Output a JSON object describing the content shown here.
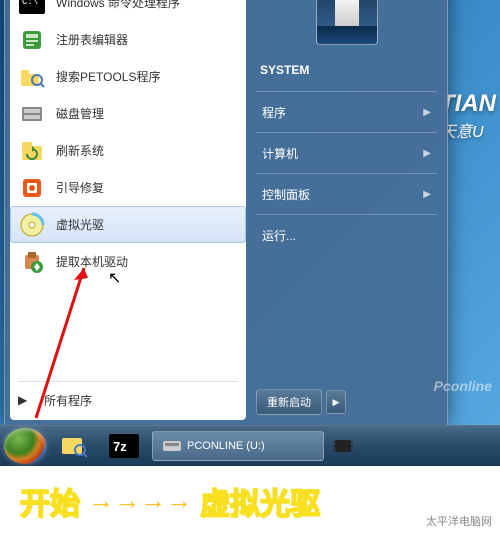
{
  "logo": {
    "main": "TIAN",
    "sub": "天意U"
  },
  "user": {
    "name": "SYSTEM"
  },
  "left_items": [
    {
      "label": "Windows 命令处理程序",
      "icon": "cmd"
    },
    {
      "label": "注册表编辑器",
      "icon": "regedit"
    },
    {
      "label": "搜索PETOOLS程序",
      "icon": "search"
    },
    {
      "label": "磁盘管理",
      "icon": "disk-mgmt"
    },
    {
      "label": "刷新系统",
      "icon": "refresh"
    },
    {
      "label": "引导修复",
      "icon": "boot-repair"
    },
    {
      "label": "虚拟光驱",
      "icon": "virtual-cd"
    },
    {
      "label": "提取本机驱动",
      "icon": "extract-driver"
    }
  ],
  "all_programs": "所有程序",
  "right_items": [
    {
      "label": "程序",
      "chev": true
    },
    {
      "label": "计算机",
      "chev": true
    },
    {
      "label": "控制面板",
      "chev": true
    },
    {
      "label": "运行...",
      "chev": false
    }
  ],
  "shutdown": {
    "label": "重新启动"
  },
  "taskbar": {
    "task_label": "PCONLINE (U:)"
  },
  "annotation": {
    "t1": "开始",
    "arrow": "→→→→",
    "t2": "虚拟光驱"
  },
  "watermark": "Pconline",
  "watermark2": "太平洋电脑网"
}
